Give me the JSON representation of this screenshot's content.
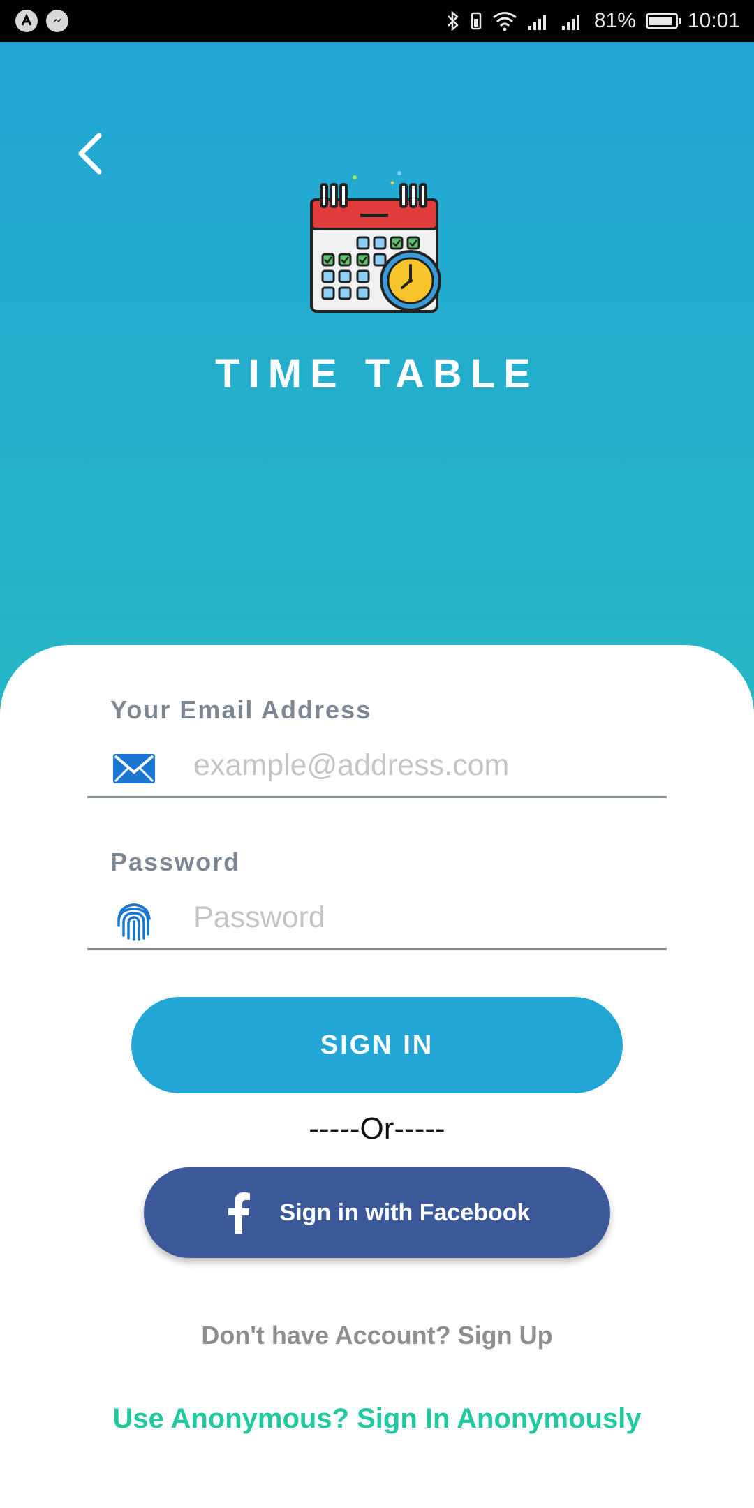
{
  "status_bar": {
    "battery_percent": "81%",
    "time": "10:01"
  },
  "header": {
    "app_title": "TIME TABLE"
  },
  "form": {
    "email_label": "Your Email Address",
    "email_placeholder": "example@address.com",
    "email_value": "",
    "password_label": "Password",
    "password_placeholder": "Password",
    "password_value": ""
  },
  "actions": {
    "sign_in_label": "SIGN IN",
    "or_divider": "-----Or-----",
    "facebook_label": "Sign in with Facebook",
    "signup_text": "Don't have Account? Sign Up",
    "anonymous_text": "Use Anonymous? Sign In Anonymously"
  },
  "colors": {
    "primary": "#23a6d5",
    "facebook": "#3b5998",
    "anonymous_link": "#22c9a0",
    "label_gray": "#7d8794"
  },
  "icons": [
    "back-arrow-icon",
    "calendar-clock-logo",
    "envelope-icon",
    "fingerprint-icon",
    "facebook-icon",
    "bluetooth-icon",
    "wifi-icon",
    "signal-icon",
    "battery-icon"
  ]
}
